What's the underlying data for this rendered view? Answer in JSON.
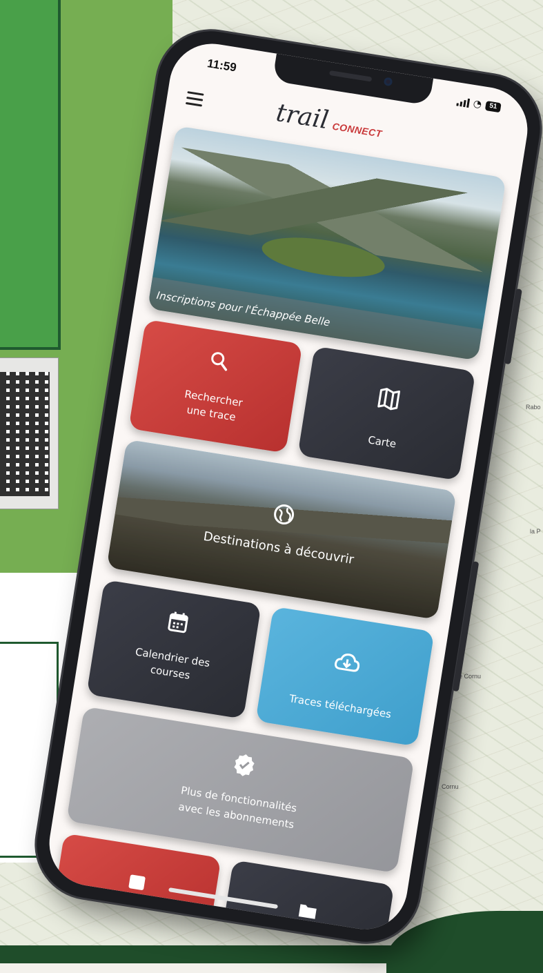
{
  "status_bar": {
    "time": "11:59",
    "battery": "51"
  },
  "app": {
    "logo_main": "trail",
    "logo_sub": "CONNECT",
    "brand_colors": {
      "red": "#c9393a",
      "dark": "#2a2c33",
      "blue": "#4aa8d5",
      "gray": "#a0a1a6"
    }
  },
  "hero": {
    "caption": "Inscriptions pour l'Échappée Belle"
  },
  "tiles": {
    "search": {
      "label_line1": "Rechercher",
      "label_line2": "une trace",
      "icon": "search-icon"
    },
    "map": {
      "label": "Carte",
      "icon": "map-icon"
    },
    "destinations": {
      "label": "Destinations à découvrir",
      "icon": "globe-icon"
    },
    "calendar": {
      "label_line1": "Calendrier des",
      "label_line2": "courses",
      "icon": "calendar-icon"
    },
    "downloads": {
      "label": "Traces téléchargées",
      "icon": "cloud-download-icon"
    },
    "subscriptions": {
      "label_line1": "Plus de fonctionnalités",
      "label_line2": "avec les abonnements",
      "icon": "verified-badge-icon"
    }
  },
  "map_labels": {
    "label1": "Rabo",
    "label2": "la P",
    "label3": "ütte Cornu",
    "label4": "Cornu"
  }
}
